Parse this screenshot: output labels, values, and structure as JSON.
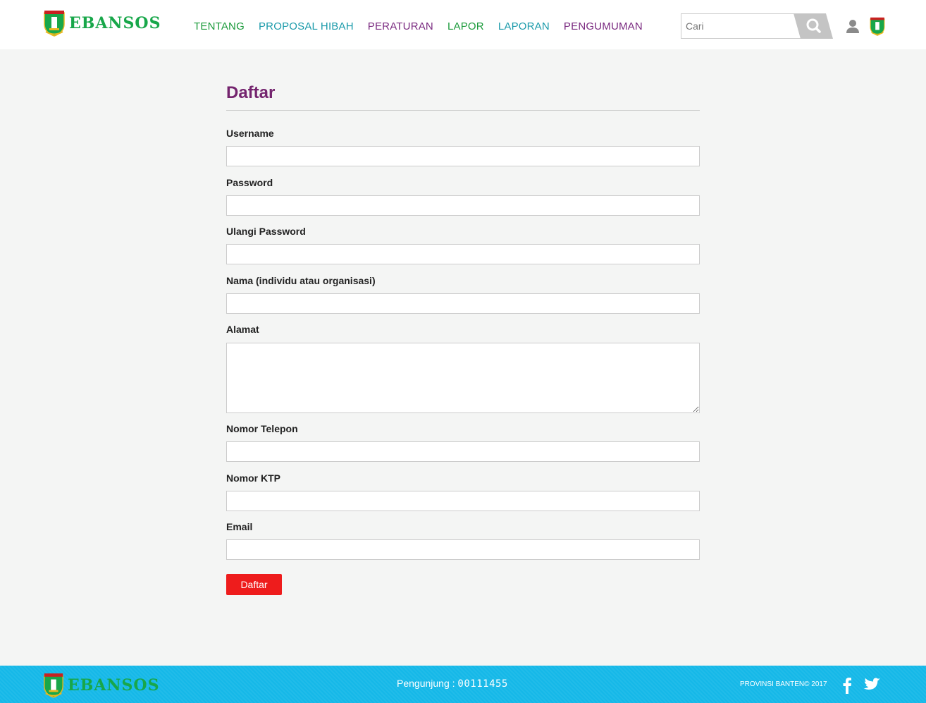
{
  "brand": {
    "logo_text": "EBANSOS",
    "primary_green": "#18a74a",
    "accent_purple": "#74246e",
    "accent_teal": "#1a9aaa",
    "button_red": "#ee1c1c",
    "footer_blue": "#15b8e8"
  },
  "nav": {
    "items": [
      {
        "label": "TENTANG",
        "color": "green"
      },
      {
        "label": "PROPOSAL HIBAH",
        "color": "teal"
      },
      {
        "label": "PERATURAN",
        "color": "purple"
      },
      {
        "label": "LAPOR",
        "color": "green"
      },
      {
        "label": "LAPORAN",
        "color": "teal"
      },
      {
        "label": "PENGUMUMAN",
        "color": "purple"
      }
    ]
  },
  "search": {
    "placeholder": "Cari",
    "icon": "search-icon"
  },
  "header_icons": {
    "user": "user-icon",
    "emblem": "banten-emblem-icon"
  },
  "form": {
    "title": "Daftar",
    "fields": {
      "username": {
        "label": "Username",
        "value": ""
      },
      "password": {
        "label": "Password",
        "value": ""
      },
      "password_repeat": {
        "label": "Ulangi Password",
        "value": ""
      },
      "name": {
        "label": "Nama (individu atau organisasi)",
        "value": ""
      },
      "address": {
        "label": "Alamat",
        "value": ""
      },
      "phone": {
        "label": "Nomor Telepon",
        "value": ""
      },
      "ktp": {
        "label": "Nomor KTP",
        "value": ""
      },
      "email": {
        "label": "Email",
        "value": ""
      }
    },
    "submit_label": "Daftar"
  },
  "footer": {
    "logo_text": "EBANSOS",
    "visitor_label": "Pengunjung :",
    "visitor_count": "00111455",
    "copyright": "PROVINSI BANTEN© 2017",
    "social": [
      "facebook-icon",
      "twitter-icon"
    ]
  }
}
